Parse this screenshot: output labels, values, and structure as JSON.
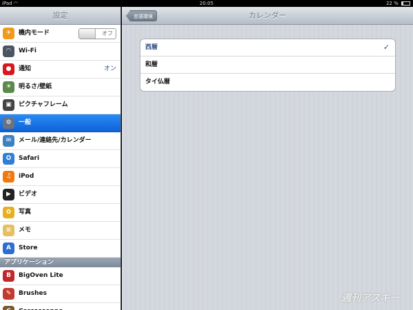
{
  "status": {
    "device": "iPad",
    "wifi_icon": "wifi-icon",
    "time": "20:05",
    "battery": "22 %",
    "battery_level_fraction": 0.22
  },
  "sidebar": {
    "title": "設定",
    "items": [
      {
        "label": "機内モード",
        "icon": "airplane-icon",
        "color": "#f09a1a",
        "toggle": "オフ"
      },
      {
        "label": "Wi-Fi",
        "icon": "wifi-icon",
        "color": "#4b5563"
      },
      {
        "label": "通知",
        "icon": "notification-icon",
        "color": "#d8181f",
        "value": "オン"
      },
      {
        "label": "明るさ/壁紙",
        "icon": "brightness-icon",
        "color": "#5a8a4a"
      },
      {
        "label": "ピクチャフレーム",
        "icon": "picture-frame-icon",
        "color": "#444"
      },
      {
        "label": "一般",
        "icon": "gear-icon",
        "color": "#6b7280",
        "selected": true
      },
      {
        "label": "メール/連絡先/カレンダー",
        "icon": "mail-icon",
        "color": "#3b82c4"
      },
      {
        "label": "Safari",
        "icon": "safari-icon",
        "color": "#2f7fd8"
      },
      {
        "label": "iPod",
        "icon": "ipod-icon",
        "color": "#f07a10"
      },
      {
        "label": "ビデオ",
        "icon": "video-icon",
        "color": "#222"
      },
      {
        "label": "写真",
        "icon": "photos-icon",
        "color": "#e8b020"
      },
      {
        "label": "メモ",
        "icon": "notes-icon",
        "color": "#e6c060"
      },
      {
        "label": "Store",
        "icon": "store-icon",
        "color": "#2d6fd0"
      }
    ],
    "apps_header": "アプリケーション",
    "apps": [
      {
        "label": "BigOven Lite",
        "icon": "bigoven-icon",
        "color": "#c0282b"
      },
      {
        "label": "Brushes",
        "icon": "brushes-icon",
        "color": "#c23b2f"
      },
      {
        "label": "Carcassonne",
        "icon": "carcassonne-icon",
        "color": "#7a5a2a"
      }
    ]
  },
  "detail": {
    "back_label": "言語環境",
    "title": "カレンダー",
    "options": [
      {
        "label": "西暦",
        "selected": true
      },
      {
        "label": "和暦",
        "selected": false
      },
      {
        "label": "タイ仏暦",
        "selected": false
      }
    ],
    "checkmark": "✓"
  },
  "watermark": "週刊アスキー"
}
